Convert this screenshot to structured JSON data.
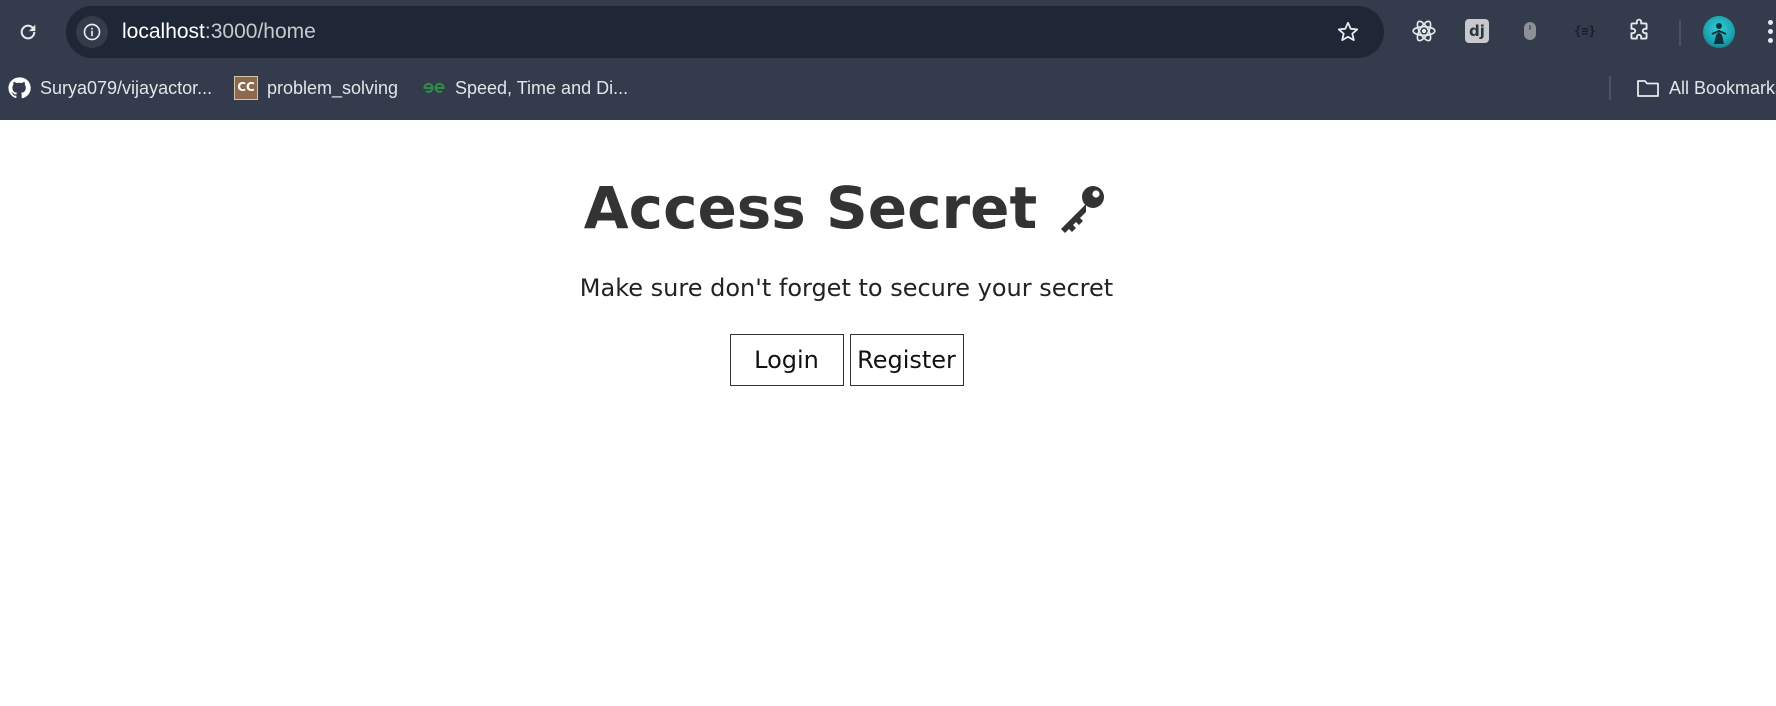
{
  "browser": {
    "url_host": "localhost",
    "url_path": ":3000/home",
    "bookmarks": [
      {
        "label": "Surya079/vijayactor...",
        "icon": "github-icon"
      },
      {
        "label": "problem_solving",
        "icon": "codechef-icon"
      },
      {
        "label": "Speed, Time and Di...",
        "icon": "geeksforgeeks-icon"
      }
    ],
    "all_bookmarks_label": "All Bookmarks",
    "extensions": [
      "react-devtools-icon",
      "django-icon",
      "mouse-extension-icon",
      "json-viewer-icon",
      "extensions-puzzle-icon"
    ],
    "json_ext_text": "{≡}",
    "django_ext_text": "dj"
  },
  "page": {
    "title": "Access Secret",
    "title_icon": "key-icon",
    "subtitle": "Make sure don't forget to secure your secret",
    "login_label": "Login",
    "register_label": "Register"
  },
  "colors": {
    "chrome_bg": "#333b4c",
    "omnibox_bg": "#1f2636",
    "title_text": "#333333"
  }
}
